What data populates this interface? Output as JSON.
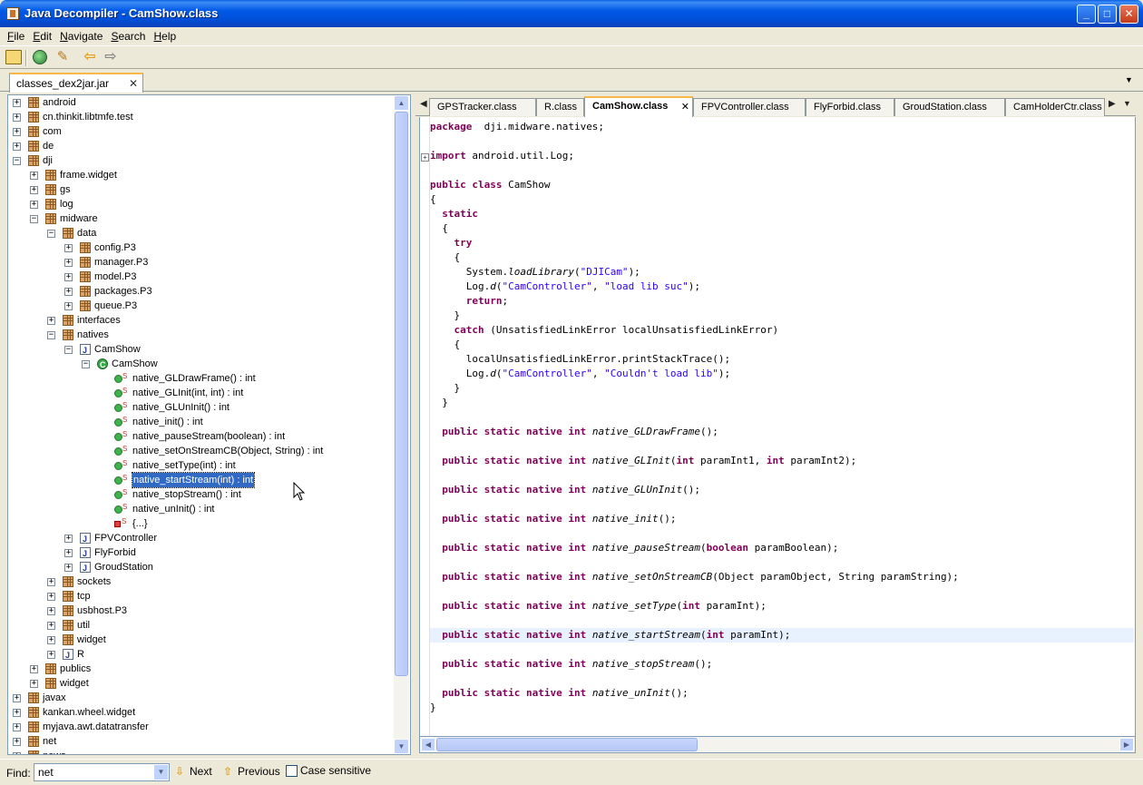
{
  "window": {
    "title": "Java Decompiler - CamShow.class",
    "minimize": "_",
    "maximize": "□",
    "close": "✕"
  },
  "menu": [
    "File",
    "Edit",
    "Navigate",
    "Search",
    "Help"
  ],
  "toolbar": {
    "icons": [
      "open-file-icon",
      "open-type-icon",
      "wand-icon",
      "back-arrow-icon",
      "forward-arrow-icon"
    ]
  },
  "jar_tab": {
    "label": "classes_dex2jar.jar",
    "close": "✕"
  },
  "tree": {
    "rows": [
      {
        "label": "android",
        "kind": "pkg",
        "level": 0,
        "exp": "+"
      },
      {
        "label": "cn.thinkit.libtmfe.test",
        "kind": "pkg",
        "level": 0,
        "exp": "+"
      },
      {
        "label": "com",
        "kind": "pkg",
        "level": 0,
        "exp": "+"
      },
      {
        "label": "de",
        "kind": "pkg",
        "level": 0,
        "exp": "+"
      },
      {
        "label": "dji",
        "kind": "pkg",
        "level": 0,
        "exp": "-"
      },
      {
        "label": "frame.widget",
        "kind": "pkg",
        "level": 1,
        "exp": "+"
      },
      {
        "label": "gs",
        "kind": "pkg",
        "level": 1,
        "exp": "+"
      },
      {
        "label": "log",
        "kind": "pkg",
        "level": 1,
        "exp": "+"
      },
      {
        "label": "midware",
        "kind": "pkg",
        "level": 1,
        "exp": "-"
      },
      {
        "label": "data",
        "kind": "pkg",
        "level": 2,
        "exp": "-"
      },
      {
        "label": "config.P3",
        "kind": "pkg",
        "level": 3,
        "exp": "+"
      },
      {
        "label": "manager.P3",
        "kind": "pkg",
        "level": 3,
        "exp": "+"
      },
      {
        "label": "model.P3",
        "kind": "pkg",
        "level": 3,
        "exp": "+"
      },
      {
        "label": "packages.P3",
        "kind": "pkg",
        "level": 3,
        "exp": "+"
      },
      {
        "label": "queue.P3",
        "kind": "pkg",
        "level": 3,
        "exp": "+"
      },
      {
        "label": "interfaces",
        "kind": "pkg",
        "level": 2,
        "exp": "+"
      },
      {
        "label": "natives",
        "kind": "pkg",
        "level": 2,
        "exp": "-"
      },
      {
        "label": "CamShow",
        "kind": "jfile",
        "level": 3,
        "exp": "-"
      },
      {
        "label": "CamShow",
        "kind": "cls",
        "level": 4,
        "exp": "-"
      },
      {
        "label": "native_GLDrawFrame() : int",
        "kind": "meth",
        "level": 5,
        "exp": ""
      },
      {
        "label": "native_GLInit(int, int) : int",
        "kind": "meth",
        "level": 5,
        "exp": ""
      },
      {
        "label": "native_GLUnInit() : int",
        "kind": "meth",
        "level": 5,
        "exp": ""
      },
      {
        "label": "native_init() : int",
        "kind": "meth",
        "level": 5,
        "exp": ""
      },
      {
        "label": "native_pauseStream(boolean) : int",
        "kind": "meth",
        "level": 5,
        "exp": ""
      },
      {
        "label": "native_setOnStreamCB(Object, String) : int",
        "kind": "meth",
        "level": 5,
        "exp": ""
      },
      {
        "label": "native_setType(int) : int",
        "kind": "meth",
        "level": 5,
        "exp": ""
      },
      {
        "label": "native_startStream(int) : int",
        "kind": "meth",
        "level": 5,
        "exp": "",
        "selected": true
      },
      {
        "label": "native_stopStream() : int",
        "kind": "meth",
        "level": 5,
        "exp": ""
      },
      {
        "label": "native_unInit() : int",
        "kind": "meth",
        "level": 5,
        "exp": ""
      },
      {
        "label": "{...}",
        "kind": "init",
        "level": 5,
        "exp": ""
      },
      {
        "label": "FPVController",
        "kind": "jfile",
        "level": 3,
        "exp": "+"
      },
      {
        "label": "FlyForbid",
        "kind": "jfile",
        "level": 3,
        "exp": "+"
      },
      {
        "label": "GroudStation",
        "kind": "jfile",
        "level": 3,
        "exp": "+"
      },
      {
        "label": "sockets",
        "kind": "pkg",
        "level": 2,
        "exp": "+"
      },
      {
        "label": "tcp",
        "kind": "pkg",
        "level": 2,
        "exp": "+"
      },
      {
        "label": "usbhost.P3",
        "kind": "pkg",
        "level": 2,
        "exp": "+"
      },
      {
        "label": "util",
        "kind": "pkg",
        "level": 2,
        "exp": "+"
      },
      {
        "label": "widget",
        "kind": "pkg",
        "level": 2,
        "exp": "+"
      },
      {
        "label": "R",
        "kind": "jfile",
        "level": 2,
        "exp": "+"
      },
      {
        "label": "publics",
        "kind": "pkg",
        "level": 1,
        "exp": "+"
      },
      {
        "label": "widget",
        "kind": "pkg",
        "level": 1,
        "exp": "+"
      },
      {
        "label": "javax",
        "kind": "pkg",
        "level": 0,
        "exp": "+"
      },
      {
        "label": "kankan.wheel.widget",
        "kind": "pkg",
        "level": 0,
        "exp": "+"
      },
      {
        "label": "myjava.awt.datatransfer",
        "kind": "pkg",
        "level": 0,
        "exp": "+"
      },
      {
        "label": "net",
        "kind": "pkg",
        "level": 0,
        "exp": "+"
      },
      {
        "label": "news",
        "kind": "pkg",
        "level": 0,
        "exp": "+"
      }
    ]
  },
  "editor_tabs": [
    {
      "label": "GPSTracker.class",
      "active": false
    },
    {
      "label": "R.class",
      "active": false
    },
    {
      "label": "CamShow.class",
      "active": true
    },
    {
      "label": "FPVController.class",
      "active": false
    },
    {
      "label": "FlyForbid.class",
      "active": false
    },
    {
      "label": "GroudStation.class",
      "active": false
    },
    {
      "label": "CamHolderCtr.class",
      "active": false
    }
  ],
  "code_lines": [
    [
      [
        "kw",
        "package"
      ],
      [
        "",
        "  dji.midware.natives;"
      ]
    ],
    [],
    [
      [
        "kw",
        "import"
      ],
      [
        "",
        " android.util.Log;"
      ]
    ],
    [],
    [
      [
        "kw",
        "public class"
      ],
      [
        "",
        " CamShow"
      ]
    ],
    [
      [
        "",
        "{"
      ]
    ],
    [
      [
        "",
        "  "
      ],
      [
        "kw",
        "static"
      ]
    ],
    [
      [
        "",
        "  {"
      ]
    ],
    [
      [
        "",
        "    "
      ],
      [
        "kw",
        "try"
      ]
    ],
    [
      [
        "",
        "    {"
      ]
    ],
    [
      [
        "",
        "      System."
      ],
      [
        "it",
        "loadLibrary"
      ],
      [
        "",
        "("
      ],
      [
        "st",
        "\"DJICam\""
      ],
      [
        "",
        ");"
      ]
    ],
    [
      [
        "",
        "      Log."
      ],
      [
        "it",
        "d"
      ],
      [
        "",
        "("
      ],
      [
        "st",
        "\"CamController\""
      ],
      [
        "",
        ", "
      ],
      [
        "st",
        "\"load lib suc\""
      ],
      [
        "",
        ");"
      ]
    ],
    [
      [
        "",
        "      "
      ],
      [
        "kw",
        "return"
      ],
      [
        "",
        ";"
      ]
    ],
    [
      [
        "",
        "    }"
      ]
    ],
    [
      [
        "",
        "    "
      ],
      [
        "kw",
        "catch"
      ],
      [
        "",
        " (UnsatisfiedLinkError localUnsatisfiedLinkError)"
      ]
    ],
    [
      [
        "",
        "    {"
      ]
    ],
    [
      [
        "",
        "      localUnsatisfiedLinkError.printStackTrace();"
      ]
    ],
    [
      [
        "",
        "      Log."
      ],
      [
        "it",
        "d"
      ],
      [
        "",
        "("
      ],
      [
        "st",
        "\"CamController\""
      ],
      [
        "",
        ", "
      ],
      [
        "st",
        "\"Couldn't load lib\""
      ],
      [
        "",
        ");"
      ]
    ],
    [
      [
        "",
        "    }"
      ]
    ],
    [
      [
        "",
        "  }"
      ]
    ],
    [],
    [
      [
        "",
        "  "
      ],
      [
        "kw",
        "public static native int"
      ],
      [
        "",
        " "
      ],
      [
        "it",
        "native_GLDrawFrame"
      ],
      [
        "",
        "();"
      ]
    ],
    [],
    [
      [
        "",
        "  "
      ],
      [
        "kw",
        "public static native int"
      ],
      [
        "",
        " "
      ],
      [
        "it",
        "native_GLInit"
      ],
      [
        "",
        "("
      ],
      [
        "kw",
        "int"
      ],
      [
        "",
        " paramInt1, "
      ],
      [
        "kw",
        "int"
      ],
      [
        "",
        " paramInt2);"
      ]
    ],
    [],
    [
      [
        "",
        "  "
      ],
      [
        "kw",
        "public static native int"
      ],
      [
        "",
        " "
      ],
      [
        "it",
        "native_GLUnInit"
      ],
      [
        "",
        "();"
      ]
    ],
    [],
    [
      [
        "",
        "  "
      ],
      [
        "kw",
        "public static native int"
      ],
      [
        "",
        " "
      ],
      [
        "it",
        "native_init"
      ],
      [
        "",
        "();"
      ]
    ],
    [],
    [
      [
        "",
        "  "
      ],
      [
        "kw",
        "public static native int"
      ],
      [
        "",
        " "
      ],
      [
        "it",
        "native_pauseStream"
      ],
      [
        "",
        "("
      ],
      [
        "kw",
        "boolean"
      ],
      [
        "",
        " paramBoolean);"
      ]
    ],
    [],
    [
      [
        "",
        "  "
      ],
      [
        "kw",
        "public static native int"
      ],
      [
        "",
        " "
      ],
      [
        "it",
        "native_setOnStreamCB"
      ],
      [
        "",
        "(Object paramObject, String paramString);"
      ]
    ],
    [],
    [
      [
        "",
        "  "
      ],
      [
        "kw",
        "public static native int"
      ],
      [
        "",
        " "
      ],
      [
        "it",
        "native_setType"
      ],
      [
        "",
        "("
      ],
      [
        "kw",
        "int"
      ],
      [
        "",
        " paramInt);"
      ]
    ],
    [],
    [
      [
        "",
        "  "
      ],
      [
        "kw",
        "public static native int"
      ],
      [
        "",
        " "
      ],
      [
        "it",
        "native_startStream"
      ],
      [
        "",
        "("
      ],
      [
        "kw",
        "int"
      ],
      [
        "",
        " paramInt);"
      ]
    ],
    [],
    [
      [
        "",
        "  "
      ],
      [
        "kw",
        "public static native int"
      ],
      [
        "",
        " "
      ],
      [
        "it",
        "native_stopStream"
      ],
      [
        "",
        "();"
      ]
    ],
    [],
    [
      [
        "",
        "  "
      ],
      [
        "kw",
        "public static native int"
      ],
      [
        "",
        " "
      ],
      [
        "it",
        "native_unInit"
      ],
      [
        "",
        "();"
      ]
    ],
    [
      [
        "",
        "}"
      ]
    ]
  ],
  "highlighted_line": 35,
  "find": {
    "label": "Find:",
    "value": "net",
    "next": "Next",
    "previous": "Previous",
    "case_sensitive": "Case sensitive"
  }
}
